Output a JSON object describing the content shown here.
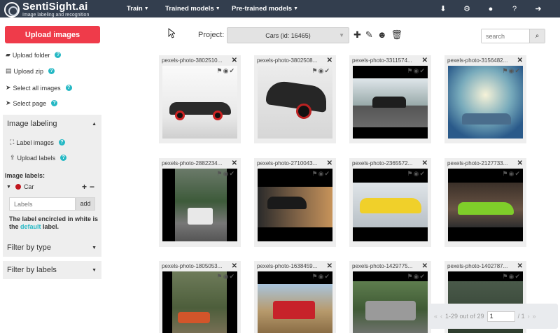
{
  "brand": {
    "name": "SentiSight.ai",
    "tagline": "Image labeling and recognition"
  },
  "nav": [
    {
      "label": "Train"
    },
    {
      "label": "Trained models"
    },
    {
      "label": "Pre-trained models"
    }
  ],
  "top_icons": [
    "download-icon",
    "gear-icon",
    "user-icon",
    "help-icon",
    "sign-out-icon"
  ],
  "sidebar": {
    "upload_images": "Upload images",
    "links": [
      {
        "label": "Upload folder",
        "icon": "folder-upload-icon"
      },
      {
        "label": "Upload zip",
        "icon": "file-zip-icon"
      },
      {
        "label": "Select all images",
        "icon": "cursor-icon"
      },
      {
        "label": "Select page",
        "icon": "cursor-icon"
      }
    ],
    "image_labeling": {
      "title": "Image labeling",
      "label_images": "Label images",
      "upload_labels": "Upload labels",
      "labels_title": "Image labels:",
      "label_name": "Car",
      "label_color": "#c0161e",
      "input_placeholder": "Labels",
      "add_button": "add",
      "note_prefix": "The label encircled in white is the",
      "note_default": "default",
      "note_suffix": "label."
    },
    "filter_by_type": "Filter by type",
    "filter_by_labels": "Filter by labels"
  },
  "project": {
    "label": "Project:",
    "selected": "Cars (id: 16465)",
    "search_placeholder": "search"
  },
  "images": [
    {
      "title": "pexels-photo-3802510..."
    },
    {
      "title": "pexels-photo-3802508..."
    },
    {
      "title": "pexels-photo-3311574..."
    },
    {
      "title": "pexels-photo-3156482..."
    },
    {
      "title": "pexels-photo-2882234..."
    },
    {
      "title": "pexels-photo-2710043..."
    },
    {
      "title": "pexels-photo-2365572..."
    },
    {
      "title": "pexels-photo-2127733..."
    },
    {
      "title": "pexels-photo-1805053..."
    },
    {
      "title": "pexels-photo-1638459..."
    },
    {
      "title": "pexels-photo-1429775..."
    },
    {
      "title": "pexels-photo-1402787..."
    }
  ],
  "pager": {
    "range": "1-29 out of 29",
    "page": "1",
    "total": "/ 1"
  }
}
